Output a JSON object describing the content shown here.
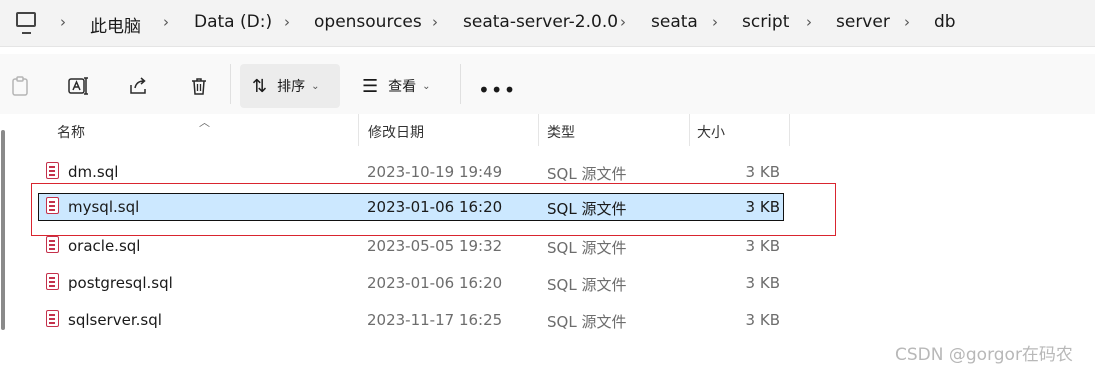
{
  "breadcrumb": {
    "items": [
      "此电脑",
      "Data (D:)",
      "opensources",
      "seata-server-2.0.0",
      "seata",
      "script",
      "server",
      "db"
    ],
    "separator": "›"
  },
  "toolbar": {
    "sort_label": "排序",
    "view_label": "查看",
    "more_label": "•••",
    "caret": "⌄"
  },
  "columns": {
    "name": "名称",
    "modified": "修改日期",
    "type": "类型",
    "size": "大小"
  },
  "files": [
    {
      "name": "dm.sql",
      "modified": "2023-10-19 19:49",
      "type": "SQL 源文件",
      "size": "3 KB"
    },
    {
      "name": "mysql.sql",
      "modified": "2023-01-06 16:20",
      "type": "SQL 源文件",
      "size": "3 KB"
    },
    {
      "name": "oracle.sql",
      "modified": "2023-05-05 19:32",
      "type": "SQL 源文件",
      "size": "3 KB"
    },
    {
      "name": "postgresql.sql",
      "modified": "2023-01-06 16:20",
      "type": "SQL 源文件",
      "size": "3 KB"
    },
    {
      "name": "sqlserver.sql",
      "modified": "2023-11-17 16:25",
      "type": "SQL 源文件",
      "size": "3 KB"
    }
  ],
  "selected_index": 1,
  "watermark": "CSDN @gorgor在码农",
  "colors": {
    "selection": "#cce8ff",
    "highlight": "#d9252f",
    "sql_icon": "#c4314b"
  }
}
